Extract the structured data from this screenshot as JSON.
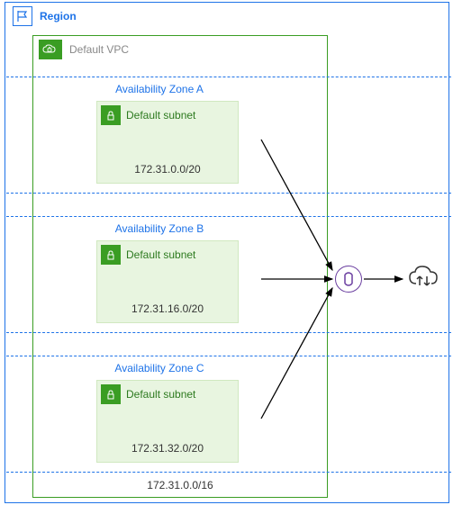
{
  "region": {
    "label": "Region"
  },
  "vpc": {
    "label": "Default VPC",
    "cidr": "172.31.0.0/16"
  },
  "azs": [
    {
      "label": "Availability Zone A",
      "subnet_label": "Default subnet",
      "cidr": "172.31.0.0/20"
    },
    {
      "label": "Availability Zone B",
      "subnet_label": "Default subnet",
      "cidr": "172.31.16.0/20"
    },
    {
      "label": "Availability Zone C",
      "subnet_label": "Default subnet",
      "cidr": "172.31.32.0/20"
    }
  ],
  "gateway": {
    "name": "internet-gateway"
  },
  "cloud": {
    "name": "internet"
  }
}
